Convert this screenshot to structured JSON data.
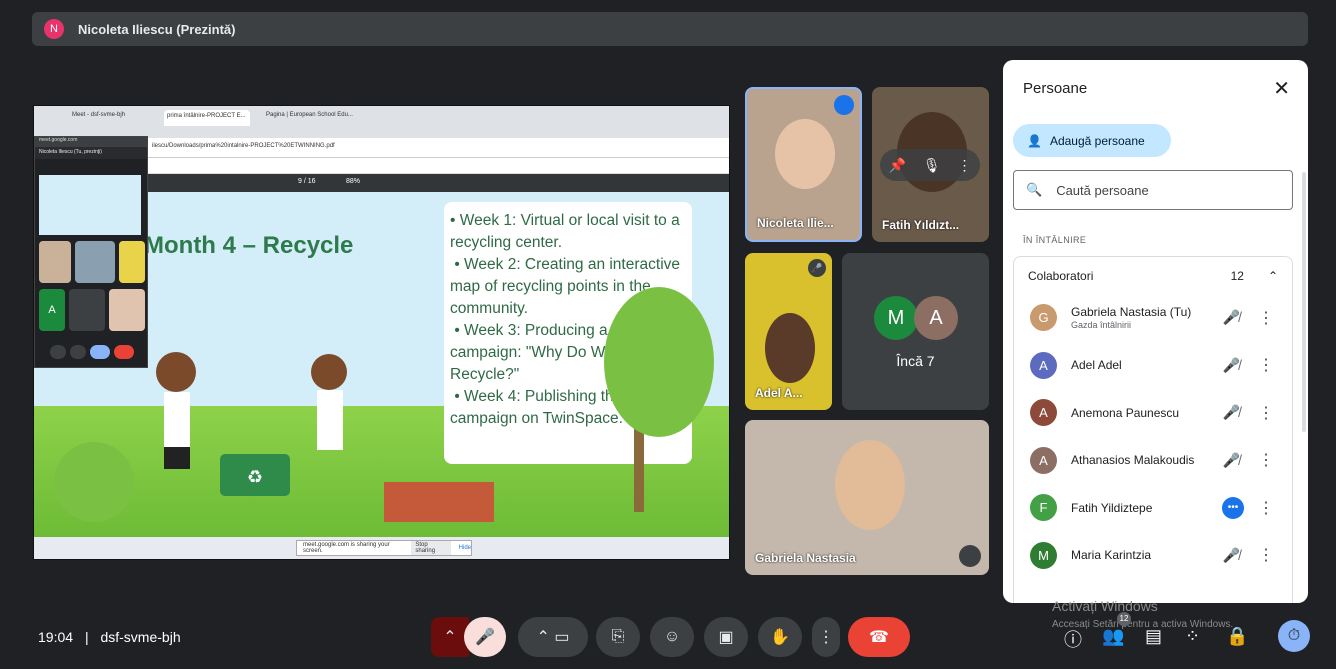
{
  "presenter_bar": {
    "avatar_letter": "N",
    "text": "Nicoleta Iliescu (Prezintă)"
  },
  "shared_screen": {
    "browser_tabs": [
      "Meet - dsf-svme-bjh",
      "prima întâlnire-PROJECT E...",
      "Pagina | European School Edu..."
    ],
    "address": "ilescu/Downloads/prima%20intalnire-PROJECT%20ETWINNING.pdf",
    "pdf_page": "9 / 16",
    "pdf_zoom": "88%",
    "slide_title": "Month 4 – Recycle",
    "slide_points": [
      "• Week 1: Virtual or local visit to a recycling center.",
      " • Week 2: Creating an interactive map of recycling points in the community.",
      " • Week 3: Producing a video campaign: \"Why Do We Recycle?\"",
      " • Week 4: Publishing the campaign on TwinSpace."
    ],
    "sharing_notice": "meet.google.com is sharing your screen.",
    "stop_sharing": "Stop sharing",
    "hide": "Hide",
    "mini_window": {
      "title": "meet.google.com",
      "presenter": "Nicoleta Iliescu (Tu, prezinţi)",
      "tile_letter": "A"
    }
  },
  "video_tiles": [
    {
      "label": "Nicoleta Ilie..."
    },
    {
      "label": "Fatih Yıldızt..."
    },
    {
      "label": "Adel A..."
    },
    {
      "label": "Încă 7",
      "avatars": [
        "M",
        "A"
      ]
    },
    {
      "label": "Gabriela Nastasia"
    }
  ],
  "people_panel": {
    "title": "Persoane",
    "add_label": "Adaugă persoane",
    "search_placeholder": "Caută persoane",
    "section": "ÎN ÎNTÂLNIRE",
    "group": "Colaboratori",
    "group_count": "12",
    "people": [
      {
        "name": "Gabriela Nastasia (Tu)",
        "sub": "Gazda întâlnirii",
        "initial": "G",
        "color": "#c99a6e",
        "state": "muted"
      },
      {
        "name": "Adel Adel",
        "sub": "",
        "initial": "A",
        "color": "#5c6bc0",
        "state": "muted"
      },
      {
        "name": "Anemona Paunescu",
        "sub": "",
        "initial": "A",
        "color": "#8d4a3a",
        "state": "muted"
      },
      {
        "name": "Athanasios Malakoudis",
        "sub": "",
        "initial": "A",
        "color": "#8d6e63",
        "state": "muted"
      },
      {
        "name": "Fatih Yildiztepe",
        "sub": "",
        "initial": "F",
        "color": "#43a047",
        "state": "speaking"
      },
      {
        "name": "Maria Karintzia",
        "sub": "",
        "initial": "M",
        "color": "#2e7d32",
        "state": "muted"
      }
    ]
  },
  "bottom_bar": {
    "time": "19:04",
    "separator": "|",
    "meeting_code": "dsf-svme-bjh",
    "people_badge": "12"
  },
  "watermark": {
    "line1": "Activați Windows",
    "line2": "Accesați Setări pentru a activa Windows."
  }
}
